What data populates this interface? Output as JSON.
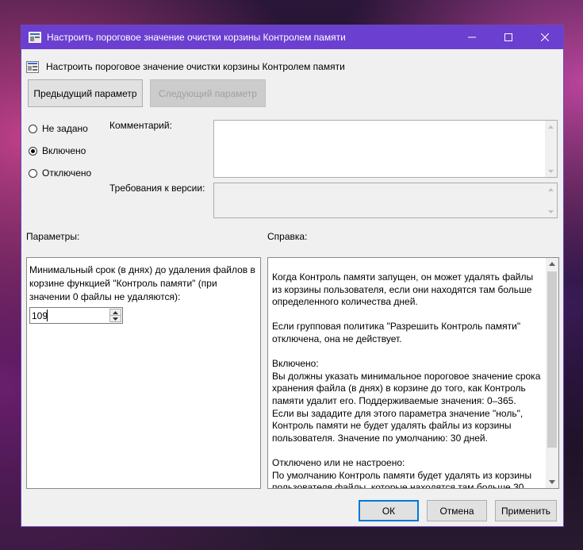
{
  "window": {
    "title": "Настроить пороговое значение очистки корзины Контролем памяти",
    "header_text": "Настроить пороговое значение очистки корзины Контролем памяти",
    "accent": "#6b3fd0"
  },
  "nav": {
    "prev_label": "Предыдущий параметр",
    "next_label": "Следующий параметр"
  },
  "state": {
    "options": [
      {
        "label": "Не задано",
        "checked": false
      },
      {
        "label": "Включено",
        "checked": true
      },
      {
        "label": "Отключено",
        "checked": false
      }
    ]
  },
  "fields": {
    "comment_label": "Комментарий:",
    "version_label": "Требования к версии:"
  },
  "sections": {
    "params_label": "Параметры:",
    "help_label": "Справка:"
  },
  "params": {
    "description": "Минимальный срок (в днях) до удаления файлов в корзине функцией \"Контроль памяти\" (при значении 0 файлы не удаляются):",
    "spin_value": "109"
  },
  "help": {
    "text": "Когда Контроль памяти запущен, он может удалять файлы из корзины пользователя, если они находятся там больше определенного количества дней.\n\nЕсли групповая политика \"Разрешить Контроль памяти\" отключена, она не действует.\n\nВключено:\nВы должны указать минимальное пороговое значение срока хранения файла (в днях) в корзине до того, как Контроль памяти удалит его. Поддерживаемые значения: 0–365.\nЕсли вы зададите для этого параметра значение \"ноль\", Контроль памяти не будет удалять файлы из корзины пользователя. Значение по умолчанию: 30 дней.\n\nОтключено или не настроено:\nПо умолчанию Контроль памяти будет удалять из корзины пользователя файлы, которые находятся там больше 30"
  },
  "footer": {
    "ok_label": "ОК",
    "cancel_label": "Отмена",
    "apply_label": "Применить"
  }
}
